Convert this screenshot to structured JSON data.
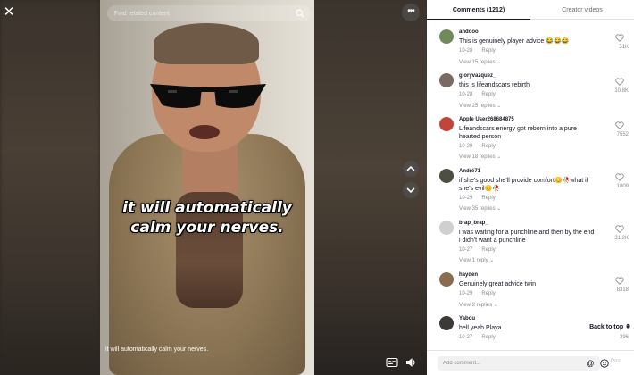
{
  "search": {
    "placeholder": "Find related content"
  },
  "video": {
    "caption_big": "it will automatically calm your nerves.",
    "caption_small": "it will automatically calm your nerves."
  },
  "icons": {
    "close": "close-icon",
    "search": "search-icon",
    "more": "more-icon",
    "up": "chevron-up-icon",
    "down": "chevron-down-icon",
    "captions": "captions-icon",
    "volume": "volume-icon",
    "like": "heart-icon",
    "mention": "at-icon",
    "emoji": "emoji-icon"
  },
  "tabs": {
    "comments": "Comments (1212)",
    "creator": "Creator videos"
  },
  "comments": [
    {
      "user": "andooo",
      "text": "This is genuinely player advice 😂😂😂",
      "date": "10-28",
      "reply": "Reply",
      "replies": "View 15 replies",
      "likes": "51K",
      "avatar_color": "#6f8b5a"
    },
    {
      "user": "gloryvazquez_",
      "text": "this is lifeandscars rebirth",
      "date": "10-28",
      "reply": "Reply",
      "replies": "View 25 replies",
      "likes": "10.8K",
      "avatar_color": "#7a6a62"
    },
    {
      "user": "Apple User268684875",
      "text": "Lifeandscars energy got reborn into a pure hearted person",
      "date": "10-29",
      "reply": "Reply",
      "replies": "View 18 replies",
      "likes": "7552",
      "avatar_color": "#c0453a"
    },
    {
      "user": "André71",
      "text": "if she's good she'll provide comfort😊🥀what if she's evil😊🥀",
      "date": "10-29",
      "reply": "Reply",
      "replies": "View 35 replies",
      "likes": "1809",
      "avatar_color": "#4d4f43"
    },
    {
      "user": "brap_brap_",
      "text": "i was waiting for a punchline and then by the end i didn't want a punchline",
      "date": "10-27",
      "reply": "Reply",
      "replies": "View 1 reply",
      "likes": "31.2K",
      "avatar_color": "#cfcfcf"
    },
    {
      "user": "hayden",
      "text": "Genuinely great advice twin",
      "date": "10-29",
      "reply": "Reply",
      "replies": "View 2 replies",
      "likes": "8318",
      "avatar_color": "#8a6d4f"
    },
    {
      "user": "Yabou",
      "text": "hell yeah Playa",
      "date": "10-27",
      "reply": "Reply",
      "replies": "",
      "likes": "296",
      "avatar_color": "#3c3a37"
    }
  ],
  "back_to_top": "Back to top",
  "composer": {
    "placeholder": "Add comment...",
    "post_label": "Post"
  },
  "colors": {
    "accent_text": "#161823",
    "muted": "#8a8b91"
  }
}
